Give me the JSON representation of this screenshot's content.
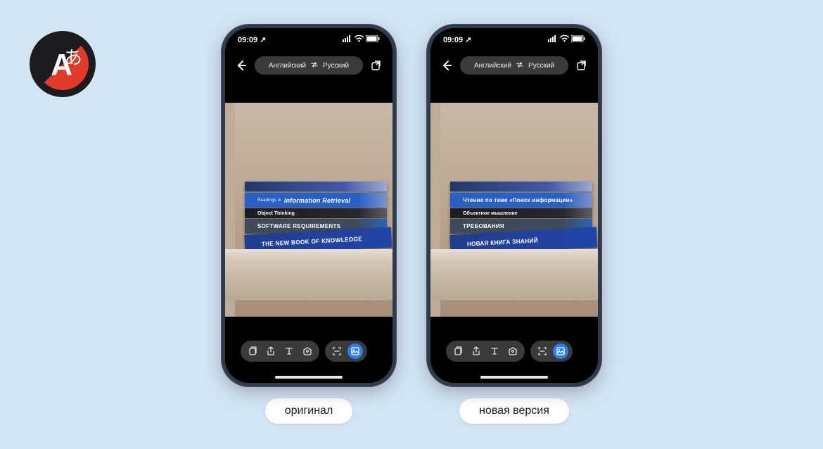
{
  "status": {
    "time": "09:09",
    "location_arrow": "↗"
  },
  "nav": {
    "lang_from": "Английский",
    "lang_to": "Русский"
  },
  "phones": {
    "left": {
      "caption": "оригинал",
      "books": {
        "b2_prefix": "Readings in",
        "b2_main": "Information Retrieval",
        "b3": "Object Thinking",
        "b4": "SOFTWARE REQUIREMENTS",
        "b5": "THE NEW BOOK OF KNOWLEDGE"
      }
    },
    "right": {
      "caption": "новая версия",
      "books": {
        "b2_main": "Чтение по теме «Поиск информации»",
        "b3": "Объектное мышление",
        "b4": "ТРЕБОВАНИЯ",
        "b5": "НОВАЯ КНИГА ЗНАНИЙ"
      }
    }
  }
}
